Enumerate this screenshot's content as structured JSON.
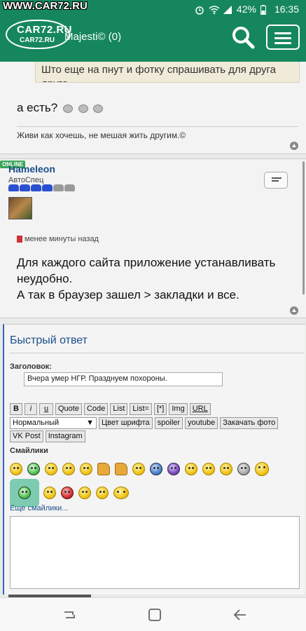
{
  "status_bar": {
    "watermark": "WWW.CAR72.RU",
    "battery": "42%",
    "time": "16:35"
  },
  "header": {
    "logo_main": "CAR72.RU",
    "logo_sub": "CAR72.RU",
    "username": "Majesti© (0)",
    "bg_color": "#16875d"
  },
  "post1": {
    "quote": "Што еще на пнут и фотку спрашивать для друга друга",
    "text": "а есть?",
    "signature": "Живи как хочешь, не мешая жить другим.©"
  },
  "post2": {
    "online_badge": "ONLINE",
    "author": "Hameleon",
    "rank": "АвтоСпец",
    "rank_cars": {
      "filled": 4,
      "total": 6
    },
    "time": "менее минуты назад",
    "text_line1": "Для каждого сайта приложение устанавливать неудобно.",
    "text_line2": "А так в браузер зашел > закладки и все."
  },
  "quick_reply": {
    "title": "Быстрый ответ",
    "subject_label": "Заголовок:",
    "subject_value": "Вчера умер НГР. Празднуем похороны.",
    "toolbar_row1": [
      "B",
      "i",
      "u",
      "Quote",
      "Code",
      "List",
      "List=",
      "[*]",
      "Img",
      "URL"
    ],
    "font_size_select": "Нормальный",
    "toolbar_row2": [
      "Цвет шрифта",
      "spoiler",
      "youtube",
      "Закачать фото"
    ],
    "toolbar_row3": [
      "VK Post",
      "Instagram"
    ],
    "smileys_label": "Смайлики",
    "more_smileys": "Еще смайлики..."
  }
}
